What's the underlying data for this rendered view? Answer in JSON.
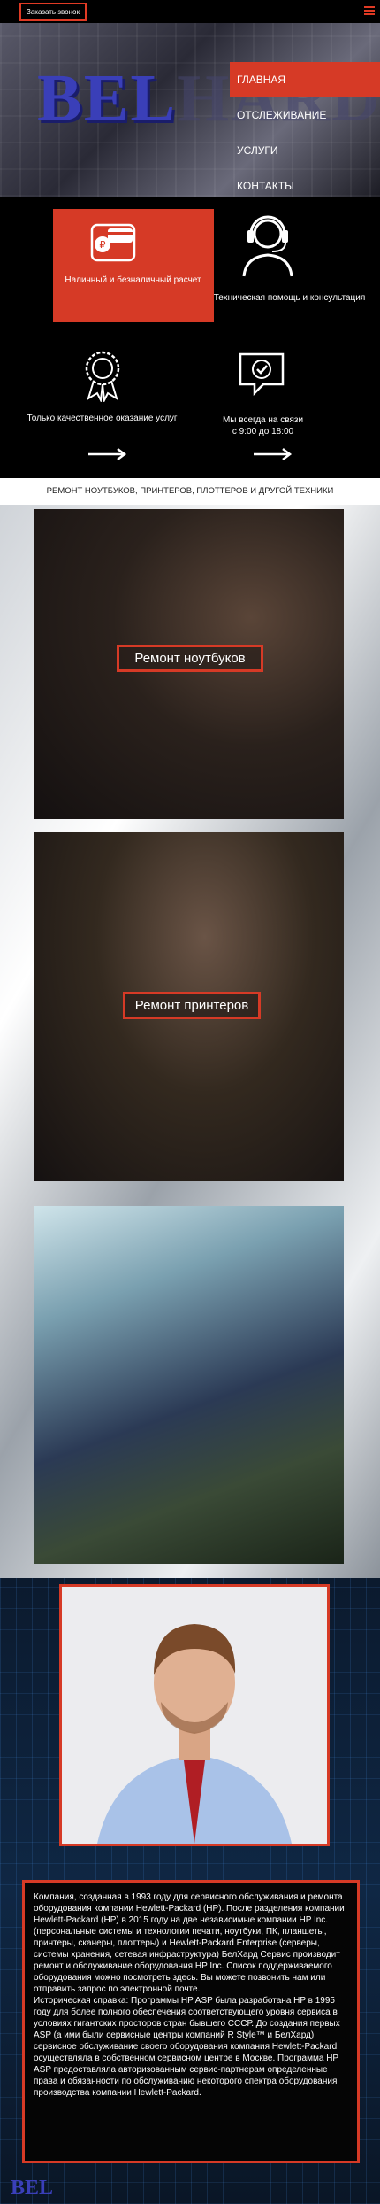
{
  "topbar": {
    "call_label": "Заказать звонок"
  },
  "hero": {
    "logo_main": "BEL",
    "logo_rest": "HARD"
  },
  "menu": {
    "items": [
      {
        "label": "ГЛАВНАЯ",
        "active": true
      },
      {
        "label": "ОТСЛЕЖИВАНИЕ",
        "active": false
      },
      {
        "label": "УСЛУГИ",
        "active": false
      },
      {
        "label": "КОНТАКТЫ",
        "active": false
      }
    ]
  },
  "features": {
    "payment": "Наличный и безналичный расчет",
    "support": "Техническая помощь и консультация",
    "quality": "Только качественное оказание услуг",
    "contact_line1": "Мы всегда на связи",
    "contact_line2": "с 9:00 до 18:00"
  },
  "section": {
    "title": "РЕМОНТ НОУТБУКОВ, ПРИНТЕРОВ, ПЛОТТЕРОВ И ДРУГОЙ ТЕХНИКИ"
  },
  "cards": [
    {
      "label": "Ремонт ноутбуков"
    },
    {
      "label": "Ремонт принтеров"
    },
    {
      "label": ""
    }
  ],
  "about": {
    "paragraph1": "Компания, созданная в 1993 году для сервисного обслуживания и ремонта оборудования компании Hewlett-Packard (HP). После разделения компании Hewlett-Packard (HP) в 2015 году на две независимые компании HP Inc. (персональные системы и технологии печати, ноутбуки, ПК, планшеты, принтеры, сканеры, плоттеры) и Hewlett-Packard Enterprise (серверы, системы хранения, сетевая инфраструктура) БелХард Сервис производит ремонт и обслуживание оборудования HP Inc. Список поддерживаемого оборудования можно посмотреть здесь. Вы можете позвонить нам или отправить запрос по электронной почте.",
    "paragraph2": "Историческая справка: Программы HP ASP была разработана HP в 1995 году для более полного обеспечения соответствующего уровня сервиса в условиях гигантских просторов стран бывшего СССР. До создания первых ASP (а ими были сервисные центры компаний R Style™ и БелХард) сервисное обслуживание своего оборудования компания Hewlett-Packard осуществляла в собственном сервисном центре в Москве. Программа HP ASP предоставляла авторизованным сервис-партнерам определенные права и обязанности по обслуживанию некоторого спектра оборудования производства компании Hewlett-Packard."
  },
  "footer": {
    "logo": "BEL"
  },
  "colors": {
    "accent": "#d63a26",
    "logo_blue": "#3a3fb8"
  }
}
